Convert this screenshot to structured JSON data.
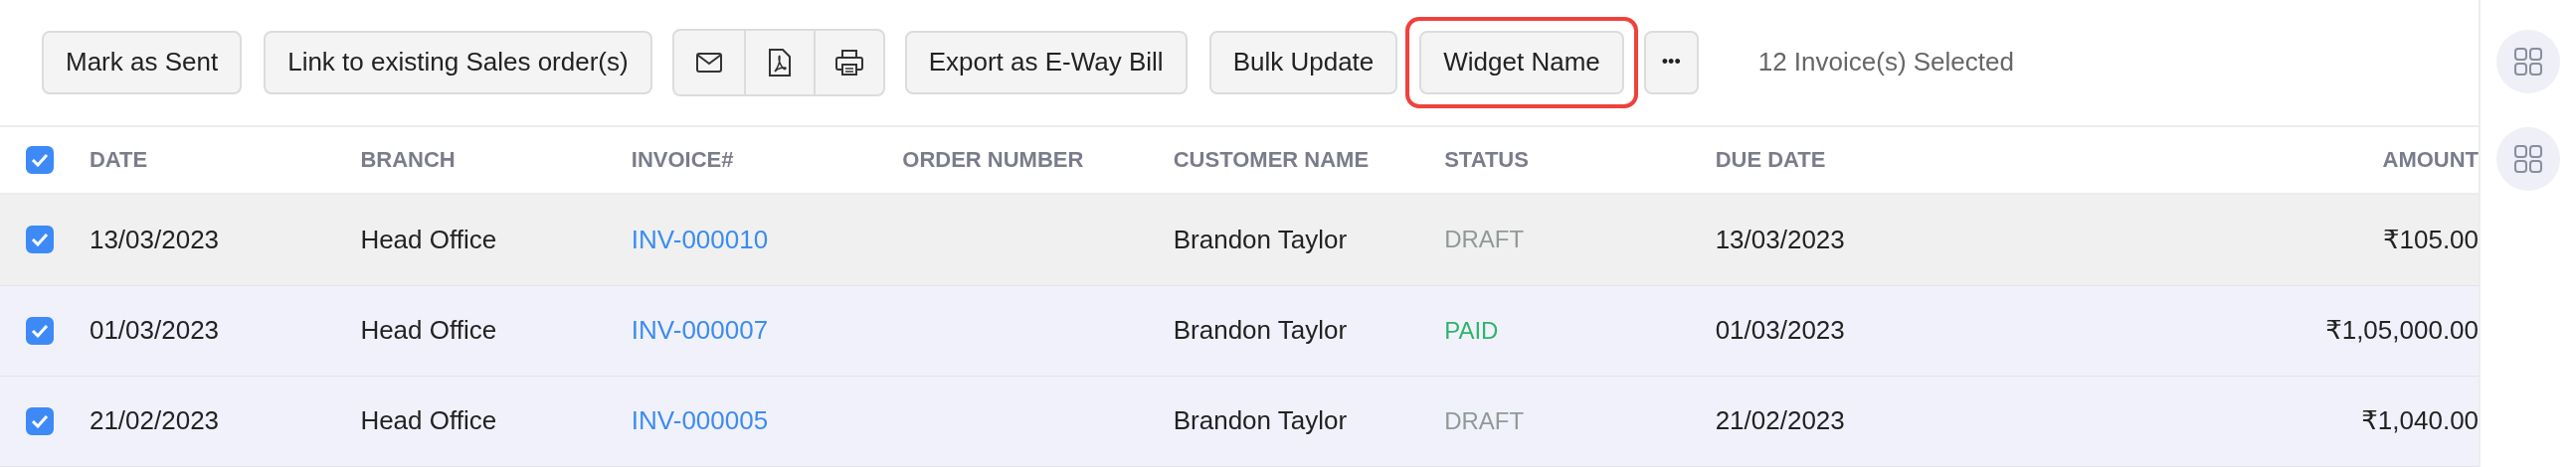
{
  "toolbar": {
    "buttons": [
      {
        "kind": "text",
        "label": "Mark as Sent",
        "outlined": false
      },
      {
        "kind": "text",
        "label": "Link to existing Sales order(s)",
        "outlined": false
      },
      {
        "kind": "icons",
        "icons": [
          {
            "kind": "mail"
          },
          {
            "kind": "pdf"
          },
          {
            "kind": "print"
          }
        ]
      },
      {
        "kind": "text",
        "label": "Export as E-Way Bill",
        "outlined": false
      },
      {
        "kind": "text",
        "label": "Bulk Update",
        "outlined": false
      },
      {
        "kind": "text",
        "label": "Widget Name",
        "outlined": true
      },
      {
        "kind": "more",
        "label": "•••"
      }
    ],
    "selection_text": "12 Invoice(s) Selected"
  },
  "table": {
    "all_checked": true,
    "columns": [
      "DATE",
      "BRANCH",
      "INVOICE#",
      "ORDER NUMBER",
      "CUSTOMER NAME",
      "STATUS",
      "DUE DATE",
      "AMOUNT"
    ],
    "rows": [
      {
        "checked": true,
        "hovered": true,
        "date": "13/03/2023",
        "branch": "Head Office",
        "invoice": "INV-000010",
        "customer": "Brandon Taylor",
        "status": {
          "text": "DRAFT",
          "color": "#8f9a96"
        },
        "due_date": "13/03/2023",
        "amount": "₹105.00"
      },
      {
        "checked": true,
        "hovered": false,
        "date": "01/03/2023",
        "branch": "Head Office",
        "invoice": "INV-000007",
        "customer": "Brandon Taylor",
        "status": {
          "text": "PAID",
          "color": "#2db56b"
        },
        "due_date": "01/03/2023",
        "amount": "₹1,05,000.00"
      },
      {
        "checked": true,
        "hovered": false,
        "date": "21/02/2023",
        "branch": "Head Office",
        "invoice": "INV-000005",
        "customer": "Brandon Taylor",
        "status": {
          "text": "DRAFT",
          "color": "#8f9a96"
        },
        "due_date": "21/02/2023",
        "amount": "₹1,040.00"
      }
    ]
  },
  "sidebar": {
    "icons": [
      {
        "kind": "widgets"
      },
      {
        "kind": "widgets"
      }
    ]
  }
}
